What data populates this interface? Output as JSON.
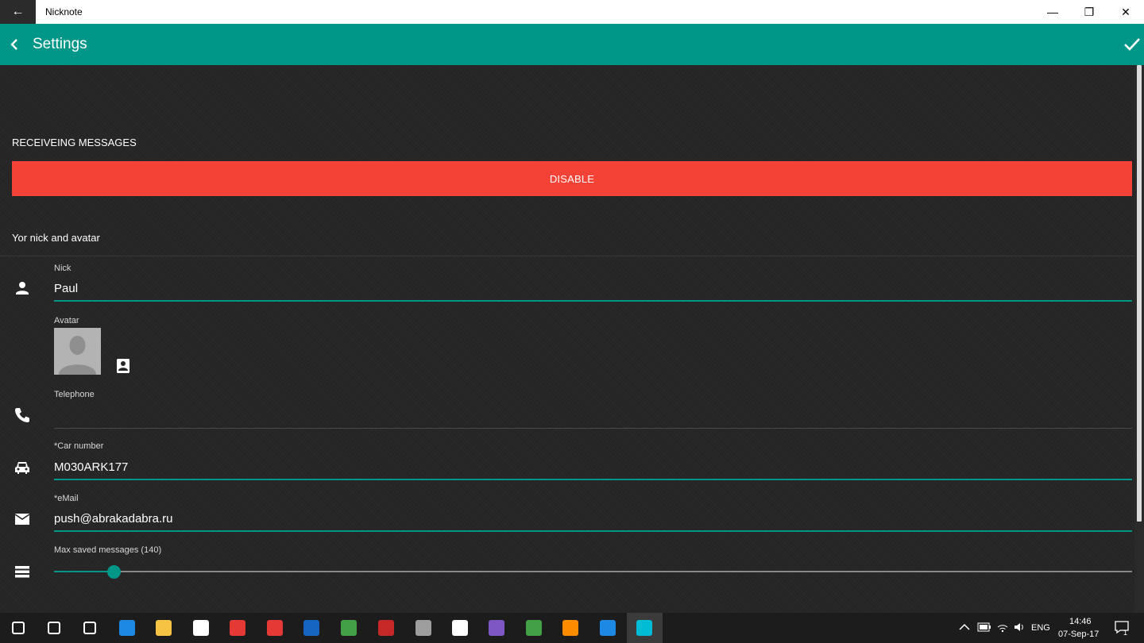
{
  "window": {
    "title": "Nicknote",
    "back_glyph": "←",
    "minimize_glyph": "—",
    "maximize_glyph": "❐",
    "close_glyph": "✕"
  },
  "appbar": {
    "title": "Settings",
    "back_icon": "chevron-left-icon",
    "confirm_icon": "check-icon",
    "color": "#009688"
  },
  "receiving": {
    "section_label": "RECEIVEING MESSAGES",
    "button_label": "DISABLE",
    "button_color": "#f44336"
  },
  "profile": {
    "section_label": "Yor nick and avatar",
    "nick": {
      "label": "Nick",
      "value": "Paul",
      "icon": "person-icon"
    },
    "avatar": {
      "label": "Avatar",
      "pick_icon": "image-picker-icon"
    },
    "telephone": {
      "label": "Telephone",
      "value": "",
      "icon": "phone-icon"
    },
    "car_number": {
      "label": "*Car number",
      "value": "M030ARK177",
      "icon": "car-icon"
    },
    "email": {
      "label": "*eMail",
      "value": "push@abrakadabra.ru",
      "icon": "mail-icon"
    },
    "max_saved": {
      "label": "Max saved messages (140)",
      "value": 140,
      "fraction": 0.056,
      "icon": "list-icon"
    }
  },
  "taskbar": {
    "apps": [
      {
        "name": "start-icon",
        "color": "#ffffff"
      },
      {
        "name": "search-icon",
        "color": "#ffffff"
      },
      {
        "name": "task-view-icon",
        "color": "#ffffff"
      },
      {
        "name": "edge-icon",
        "color": "#1e88e5"
      },
      {
        "name": "file-explorer-icon",
        "color": "#f6c343"
      },
      {
        "name": "store-icon",
        "color": "#ffffff"
      },
      {
        "name": "gift-icon",
        "color": "#e53935"
      },
      {
        "name": "yandex-browser-icon",
        "color": "#e53935"
      },
      {
        "name": "outlook-icon",
        "color": "#1565c0"
      },
      {
        "name": "chrome-icon",
        "color": "#43a047"
      },
      {
        "name": "filezilla-icon",
        "color": "#c62828"
      },
      {
        "name": "app-icon",
        "color": "#9e9e9e"
      },
      {
        "name": "mail-icon",
        "color": "#ffffff"
      },
      {
        "name": "visual-studio-icon",
        "color": "#7e57c2"
      },
      {
        "name": "evernote-icon",
        "color": "#43a047"
      },
      {
        "name": "xampp-icon",
        "color": "#fb8c00"
      },
      {
        "name": "xdk-icon",
        "color": "#1e88e5"
      },
      {
        "name": "nicknote-icon",
        "color": "#00bcd4"
      }
    ],
    "language": "ENG",
    "time": "14:46",
    "date": "07-Sep-17",
    "notification_count": "1"
  }
}
